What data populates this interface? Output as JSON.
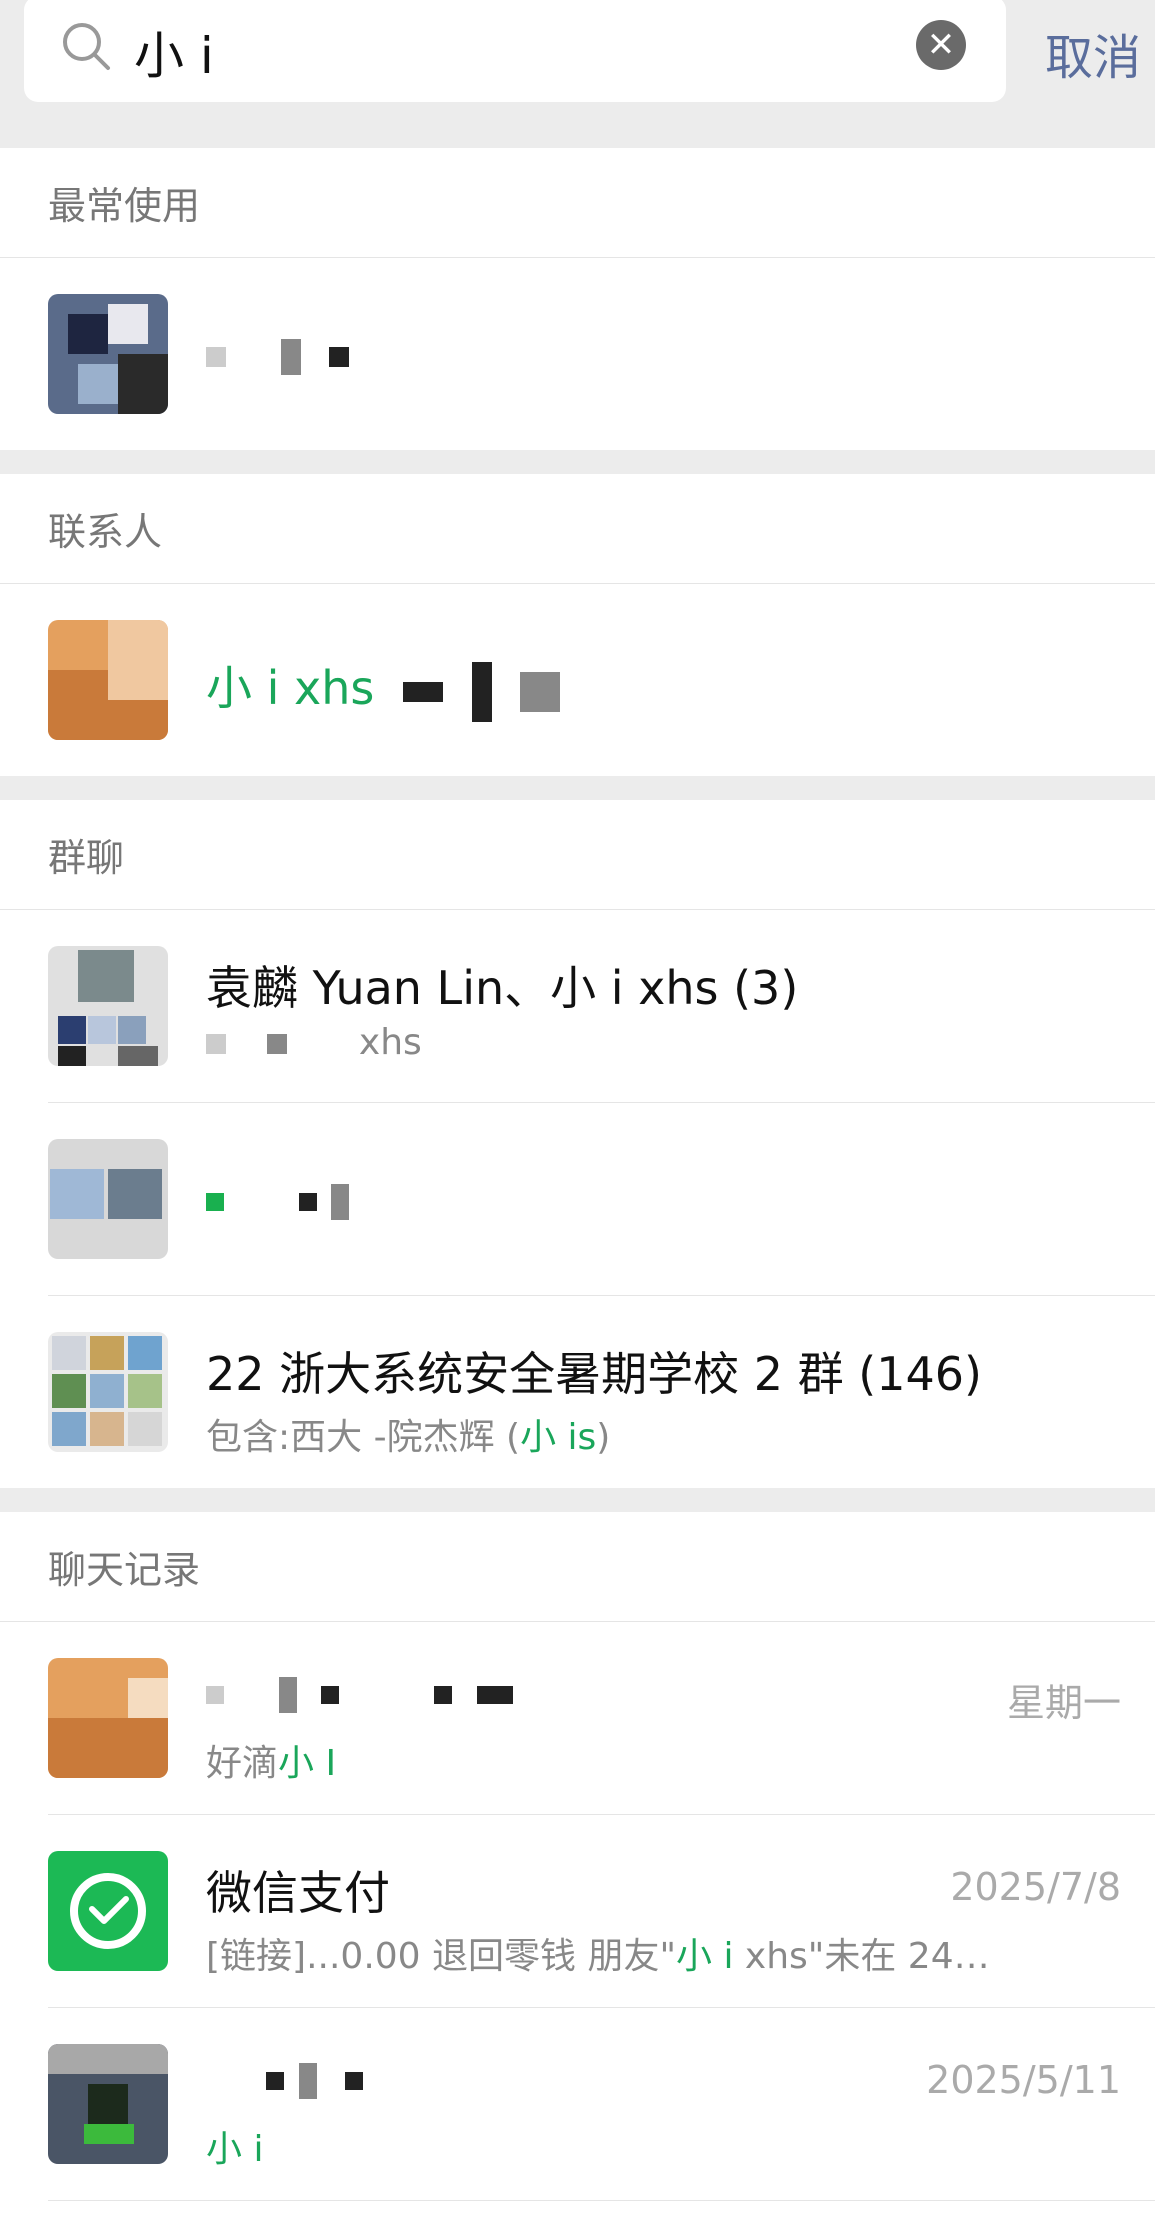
{
  "search": {
    "query": "小 i",
    "cancel_label": "取消"
  },
  "sections": {
    "frequent": {
      "title": "最常使用"
    },
    "contacts": {
      "title": "联系人",
      "items": [
        {
          "name_visible": "小 i xhs"
        }
      ]
    },
    "groups": {
      "title": "群聊",
      "items": [
        {
          "name": "袁麟 Yuan Lin、小 i xhs (3)",
          "sub": "xhs"
        },
        {
          "name": ""
        },
        {
          "name": "22 浙大系统安全暑期学校 2 群 (146)",
          "sub_prefix": "包含:西大 -院杰辉 (",
          "sub_hl": "小 is",
          "sub_suffix": ")"
        }
      ]
    },
    "chats": {
      "title": "聊天记录",
      "items": [
        {
          "name": "",
          "date": "星期一",
          "sub_prefix": "好滴",
          "sub_hl": "小 I"
        },
        {
          "name": "微信支付",
          "date": "2025/7/8",
          "sub_prefix": "[链接]...0.00 退回零钱 朋友\"",
          "sub_hl": "小 i",
          "sub_suffix": " xhs\"未在 24…"
        },
        {
          "name": "",
          "date": "2025/5/11",
          "sub_hl": "小 i"
        }
      ]
    }
  },
  "colors": {
    "highlight": "#1aa65a",
    "wechat_pay": "#1cb955",
    "cancel": "#5a6d9c"
  }
}
